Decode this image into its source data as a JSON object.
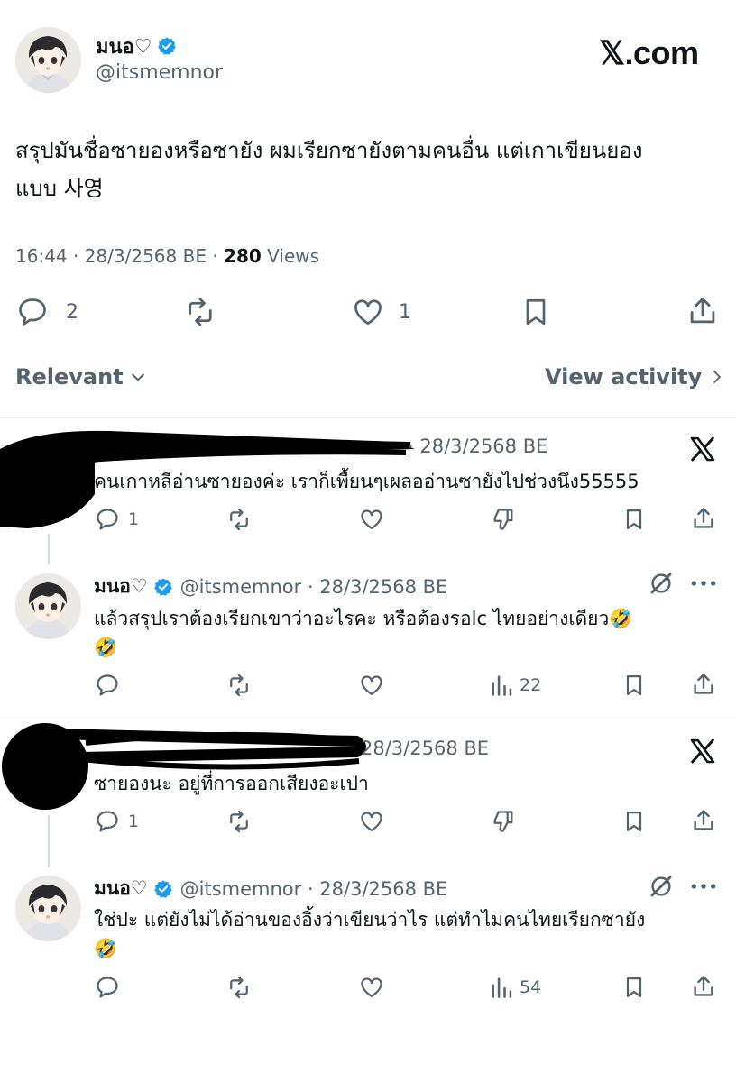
{
  "header": {
    "display_name": "มนอ♡",
    "handle": "@itsmemnor",
    "site_label": "𝕏.com"
  },
  "tweet": {
    "text_line1": "สรุปมันชื่อซายองหรือซายัง ผมเรียกซายังตามคนอื่น แต่เกาเขียนยอง",
    "text_line2": "แบบ 사영",
    "timestamp": "16:44 · 28/3/2568 BE · ",
    "views_count": "280",
    "views_label": " Views",
    "replies": "2",
    "likes": "1"
  },
  "sort": {
    "relevant_label": "Relevant",
    "view_activity_label": "View activity"
  },
  "replies": [
    {
      "meta": "· 28/3/2568 BE",
      "text": "คนเกาหลีอ่านซายองค่ะ เราก็เพื้ยนๆเผลออ่านซายังไปช่วงนึง55555",
      "reply_count": "1"
    },
    {
      "display_name": "มนอ♡",
      "meta": "@itsmemnor · 28/3/2568 BE",
      "text_line1": "แล้วสรุปเราต้องเรียกเขาว่าอะไรคะ หรือต้องรอlc ไทยอย่างเดียว🤣",
      "text_line2": "🤣",
      "views": "22"
    },
    {
      "meta": "28/3/2568 BE",
      "text": "ซายองนะ อยู่ที่การออกเสียงอะเป่า",
      "reply_count": "1"
    },
    {
      "display_name": "มนอ♡",
      "meta": "@itsmemnor · 28/3/2568 BE",
      "text_line1": "ใช่ปะ แต่ยังไม่ได้อ่านของอิ้งว่าเขียนว่าไร แต่ทำไมคนไทยเรียกซายัง",
      "text_line2": "🤣",
      "views": "54"
    }
  ],
  "colors": {
    "text": "#0f1419",
    "secondary": "#536471",
    "verified": "#1d9bf0",
    "divider": "#e6e9eb"
  },
  "icons": [
    "verified-badge-icon",
    "x-logo-icon",
    "reply-icon",
    "retweet-icon",
    "like-icon",
    "bookmark-icon",
    "share-icon",
    "chevron-down-icon",
    "chevron-right-icon",
    "dislike-icon",
    "views-icon",
    "more-icon",
    "grok-icon"
  ]
}
